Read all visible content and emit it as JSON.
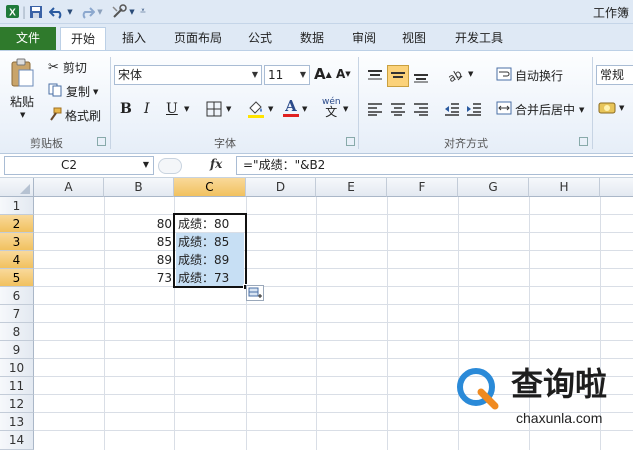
{
  "window": {
    "title": "工作簿"
  },
  "ribbon_tabs": [
    "文件",
    "开始",
    "插入",
    "页面布局",
    "公式",
    "数据",
    "审阅",
    "视图",
    "开发工具"
  ],
  "clipboard": {
    "paste": "粘贴",
    "cut": "剪切",
    "copy": "复制",
    "format_painter": "格式刷",
    "group": "剪贴板"
  },
  "font": {
    "name": "宋体",
    "size": "11",
    "group": "字体",
    "bold": "B",
    "italic": "I",
    "underline": "U",
    "grow": "A",
    "shrink": "A",
    "phonetic": "wén"
  },
  "alignment": {
    "wrap": "自动换行",
    "merge": "合并后居中",
    "group": "对齐方式"
  },
  "number": {
    "format": "常规"
  },
  "formula_bar": {
    "name_box": "C2",
    "fx": "fx",
    "formula": "=\"成绩：\"&B2"
  },
  "columns": [
    "A",
    "B",
    "C",
    "D",
    "E",
    "F",
    "G",
    "H"
  ],
  "rows": [
    "1",
    "2",
    "3",
    "4",
    "5",
    "6",
    "7",
    "8",
    "9",
    "10",
    "11",
    "12",
    "13",
    "14"
  ],
  "cells": {
    "B": [
      "80",
      "85",
      "89",
      "73"
    ],
    "C": [
      "成绩：80",
      "成绩：85",
      "成绩：89",
      "成绩：73"
    ]
  },
  "selected_cell": "C2",
  "watermark": {
    "brand": "查询啦",
    "url": "chaxunla.com"
  }
}
